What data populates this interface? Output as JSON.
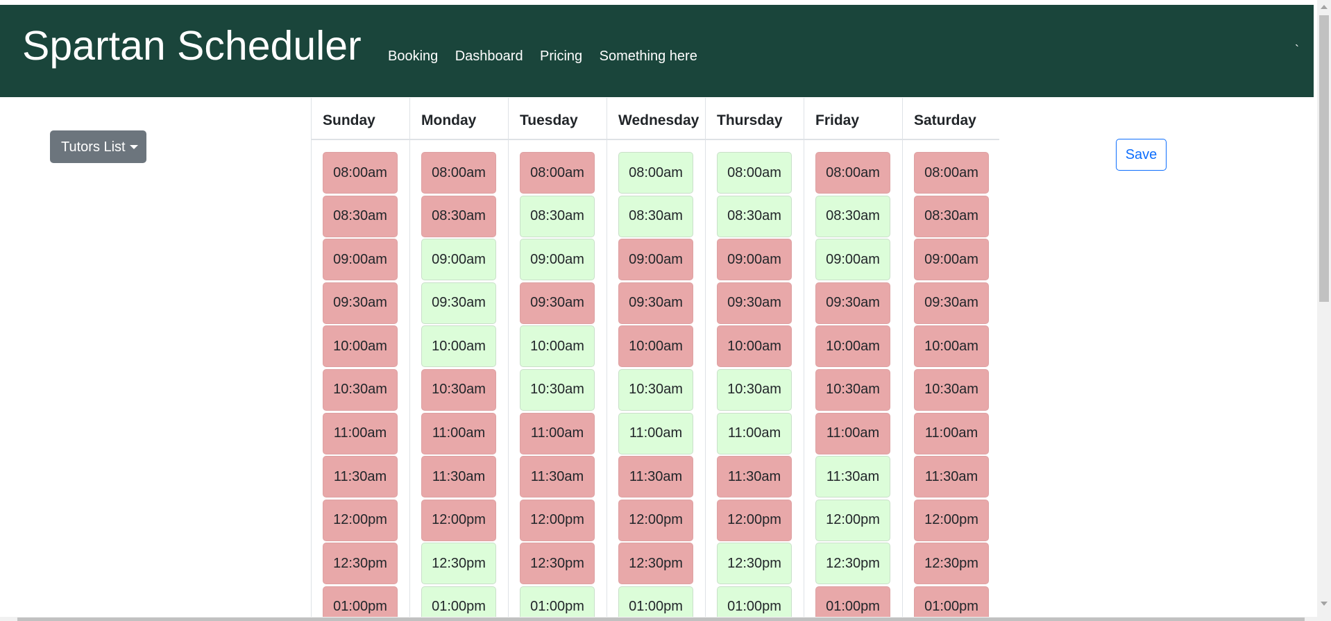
{
  "navbar": {
    "brand": "Spartan Scheduler",
    "links": [
      "Booking",
      "Dashboard",
      "Pricing",
      "Something here"
    ],
    "tick": "`",
    "background_color": "#1a453b"
  },
  "tutors_button": {
    "label": "Tutors List",
    "icon": "caret-down-icon"
  },
  "save_button": {
    "label": "Save"
  },
  "colors": {
    "booked": "#e8a8a9",
    "available": "#dcfdd9"
  },
  "schedule": {
    "days": [
      {
        "name": "Sunday",
        "slots": [
          {
            "time": "08:00am",
            "status": "booked"
          },
          {
            "time": "08:30am",
            "status": "booked"
          },
          {
            "time": "09:00am",
            "status": "booked"
          },
          {
            "time": "09:30am",
            "status": "booked"
          },
          {
            "time": "10:00am",
            "status": "booked"
          },
          {
            "time": "10:30am",
            "status": "booked"
          },
          {
            "time": "11:00am",
            "status": "booked"
          },
          {
            "time": "11:30am",
            "status": "booked"
          },
          {
            "time": "12:00pm",
            "status": "booked"
          },
          {
            "time": "12:30pm",
            "status": "booked"
          },
          {
            "time": "01:00pm",
            "status": "booked"
          }
        ]
      },
      {
        "name": "Monday",
        "slots": [
          {
            "time": "08:00am",
            "status": "booked"
          },
          {
            "time": "08:30am",
            "status": "booked"
          },
          {
            "time": "09:00am",
            "status": "free"
          },
          {
            "time": "09:30am",
            "status": "free"
          },
          {
            "time": "10:00am",
            "status": "free"
          },
          {
            "time": "10:30am",
            "status": "booked"
          },
          {
            "time": "11:00am",
            "status": "booked"
          },
          {
            "time": "11:30am",
            "status": "booked"
          },
          {
            "time": "12:00pm",
            "status": "booked"
          },
          {
            "time": "12:30pm",
            "status": "free"
          },
          {
            "time": "01:00pm",
            "status": "free"
          }
        ]
      },
      {
        "name": "Tuesday",
        "slots": [
          {
            "time": "08:00am",
            "status": "booked"
          },
          {
            "time": "08:30am",
            "status": "free"
          },
          {
            "time": "09:00am",
            "status": "free"
          },
          {
            "time": "09:30am",
            "status": "booked"
          },
          {
            "time": "10:00am",
            "status": "free"
          },
          {
            "time": "10:30am",
            "status": "free"
          },
          {
            "time": "11:00am",
            "status": "booked"
          },
          {
            "time": "11:30am",
            "status": "booked"
          },
          {
            "time": "12:00pm",
            "status": "booked"
          },
          {
            "time": "12:30pm",
            "status": "booked"
          },
          {
            "time": "01:00pm",
            "status": "free"
          }
        ]
      },
      {
        "name": "Wednesday",
        "slots": [
          {
            "time": "08:00am",
            "status": "free"
          },
          {
            "time": "08:30am",
            "status": "free"
          },
          {
            "time": "09:00am",
            "status": "booked"
          },
          {
            "time": "09:30am",
            "status": "booked"
          },
          {
            "time": "10:00am",
            "status": "booked"
          },
          {
            "time": "10:30am",
            "status": "free"
          },
          {
            "time": "11:00am",
            "status": "free"
          },
          {
            "time": "11:30am",
            "status": "booked"
          },
          {
            "time": "12:00pm",
            "status": "booked"
          },
          {
            "time": "12:30pm",
            "status": "booked"
          },
          {
            "time": "01:00pm",
            "status": "free"
          }
        ]
      },
      {
        "name": "Thursday",
        "slots": [
          {
            "time": "08:00am",
            "status": "free"
          },
          {
            "time": "08:30am",
            "status": "free"
          },
          {
            "time": "09:00am",
            "status": "booked"
          },
          {
            "time": "09:30am",
            "status": "booked"
          },
          {
            "time": "10:00am",
            "status": "booked"
          },
          {
            "time": "10:30am",
            "status": "free"
          },
          {
            "time": "11:00am",
            "status": "free"
          },
          {
            "time": "11:30am",
            "status": "booked"
          },
          {
            "time": "12:00pm",
            "status": "booked"
          },
          {
            "time": "12:30pm",
            "status": "free"
          },
          {
            "time": "01:00pm",
            "status": "free"
          }
        ]
      },
      {
        "name": "Friday",
        "slots": [
          {
            "time": "08:00am",
            "status": "booked"
          },
          {
            "time": "08:30am",
            "status": "free"
          },
          {
            "time": "09:00am",
            "status": "free"
          },
          {
            "time": "09:30am",
            "status": "booked"
          },
          {
            "time": "10:00am",
            "status": "booked"
          },
          {
            "time": "10:30am",
            "status": "booked"
          },
          {
            "time": "11:00am",
            "status": "booked"
          },
          {
            "time": "11:30am",
            "status": "free"
          },
          {
            "time": "12:00pm",
            "status": "free"
          },
          {
            "time": "12:30pm",
            "status": "free"
          },
          {
            "time": "01:00pm",
            "status": "booked"
          }
        ]
      },
      {
        "name": "Saturday",
        "slots": [
          {
            "time": "08:00am",
            "status": "booked"
          },
          {
            "time": "08:30am",
            "status": "booked"
          },
          {
            "time": "09:00am",
            "status": "booked"
          },
          {
            "time": "09:30am",
            "status": "booked"
          },
          {
            "time": "10:00am",
            "status": "booked"
          },
          {
            "time": "10:30am",
            "status": "booked"
          },
          {
            "time": "11:00am",
            "status": "booked"
          },
          {
            "time": "11:30am",
            "status": "booked"
          },
          {
            "time": "12:00pm",
            "status": "booked"
          },
          {
            "time": "12:30pm",
            "status": "booked"
          },
          {
            "time": "01:00pm",
            "status": "booked"
          }
        ]
      }
    ]
  }
}
